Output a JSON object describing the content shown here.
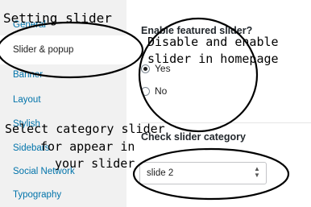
{
  "sidebar": {
    "items": [
      {
        "label": "General"
      },
      {
        "label": "Slider & popup"
      },
      {
        "label": "Banner"
      },
      {
        "label": "Layout"
      },
      {
        "label": "Stylish"
      },
      {
        "label": "Sidebars"
      },
      {
        "label": "Social Network"
      },
      {
        "label": "Typography"
      }
    ]
  },
  "content": {
    "featured": {
      "title": "Enable featured slider?",
      "options": [
        {
          "label": "Yes",
          "checked": true
        },
        {
          "label": "No",
          "checked": false
        }
      ]
    },
    "category": {
      "title": "Check slider category",
      "select_value": "slide 2"
    }
  },
  "annotations": {
    "setting_slider": "Setting slider",
    "disable_enable_line1": "Disable and enable",
    "disable_enable_line2": "slider in homepage",
    "select_category_line1": "Select category slider",
    "select_category_line2": "for appear in",
    "select_category_line3": "your slider"
  },
  "colors": {
    "sidebar_bg": "#f1f1f1",
    "link": "#0073aa",
    "text": "#1e1e1e"
  }
}
